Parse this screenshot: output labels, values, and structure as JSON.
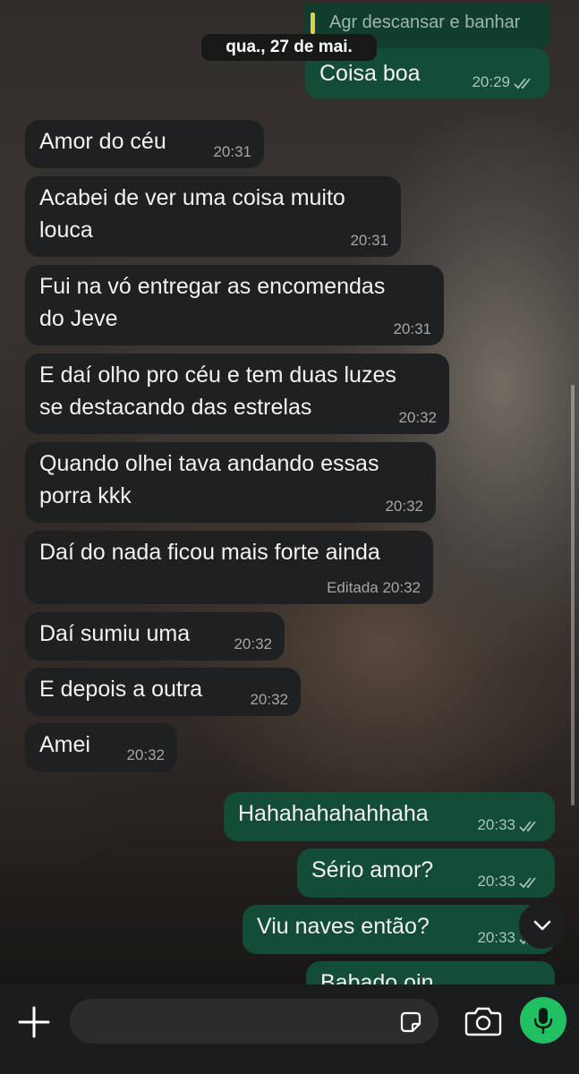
{
  "top_reply": {
    "text": "Agr descansar e banhar"
  },
  "date_pill": "qua., 27 de mai.",
  "messages": [
    {
      "dir": "out",
      "text": "Coisa boa",
      "time": "20:29"
    },
    {
      "dir": "in",
      "text": "Amor do céu",
      "time": "20:31"
    },
    {
      "dir": "in",
      "line1": "Acabei de ver uma coisa muito",
      "line2": "louca",
      "time": "20:31"
    },
    {
      "dir": "in",
      "line1": "Fui na vó entregar as encomendas",
      "line2": "do Jeve",
      "time": "20:31"
    },
    {
      "dir": "in",
      "line1": "E daí olho pro céu e tem duas luzes",
      "line2": "se destacando das estrelas",
      "time": "20:32"
    },
    {
      "dir": "in",
      "line1": "Quando olhei tava andando essas",
      "line2": "porra kkk",
      "time": "20:32"
    },
    {
      "dir": "in",
      "text": "Daí do nada ficou mais forte ainda",
      "time": "Editada 20:32"
    },
    {
      "dir": "in",
      "text": "Daí sumiu uma",
      "time": "20:32"
    },
    {
      "dir": "in",
      "text": "E depois a outra",
      "time": "20:32"
    },
    {
      "dir": "in",
      "text": "Amei",
      "time": "20:32"
    },
    {
      "dir": "out",
      "text": "Hahahahahahhaha",
      "time": "20:33"
    },
    {
      "dir": "out",
      "text": "Sério amor?",
      "time": "20:33"
    },
    {
      "dir": "out",
      "text": "Viu naves então?",
      "time": "20:33"
    },
    {
      "dir": "out",
      "text": "Babado oin",
      "time": ""
    }
  ],
  "icons": {
    "read_ticks": "double-check-icon",
    "scroll_down": "chevron-down-icon",
    "attach": "plus-icon",
    "sticker": "sticker-icon",
    "camera": "camera-icon",
    "mic": "microphone-icon"
  },
  "colors": {
    "incoming_bubble": "#1f2021",
    "outgoing_bubble": "#144d37",
    "mic_button": "#21c063",
    "reply_bar": "#e6c84b"
  },
  "input": {
    "placeholder": ""
  }
}
